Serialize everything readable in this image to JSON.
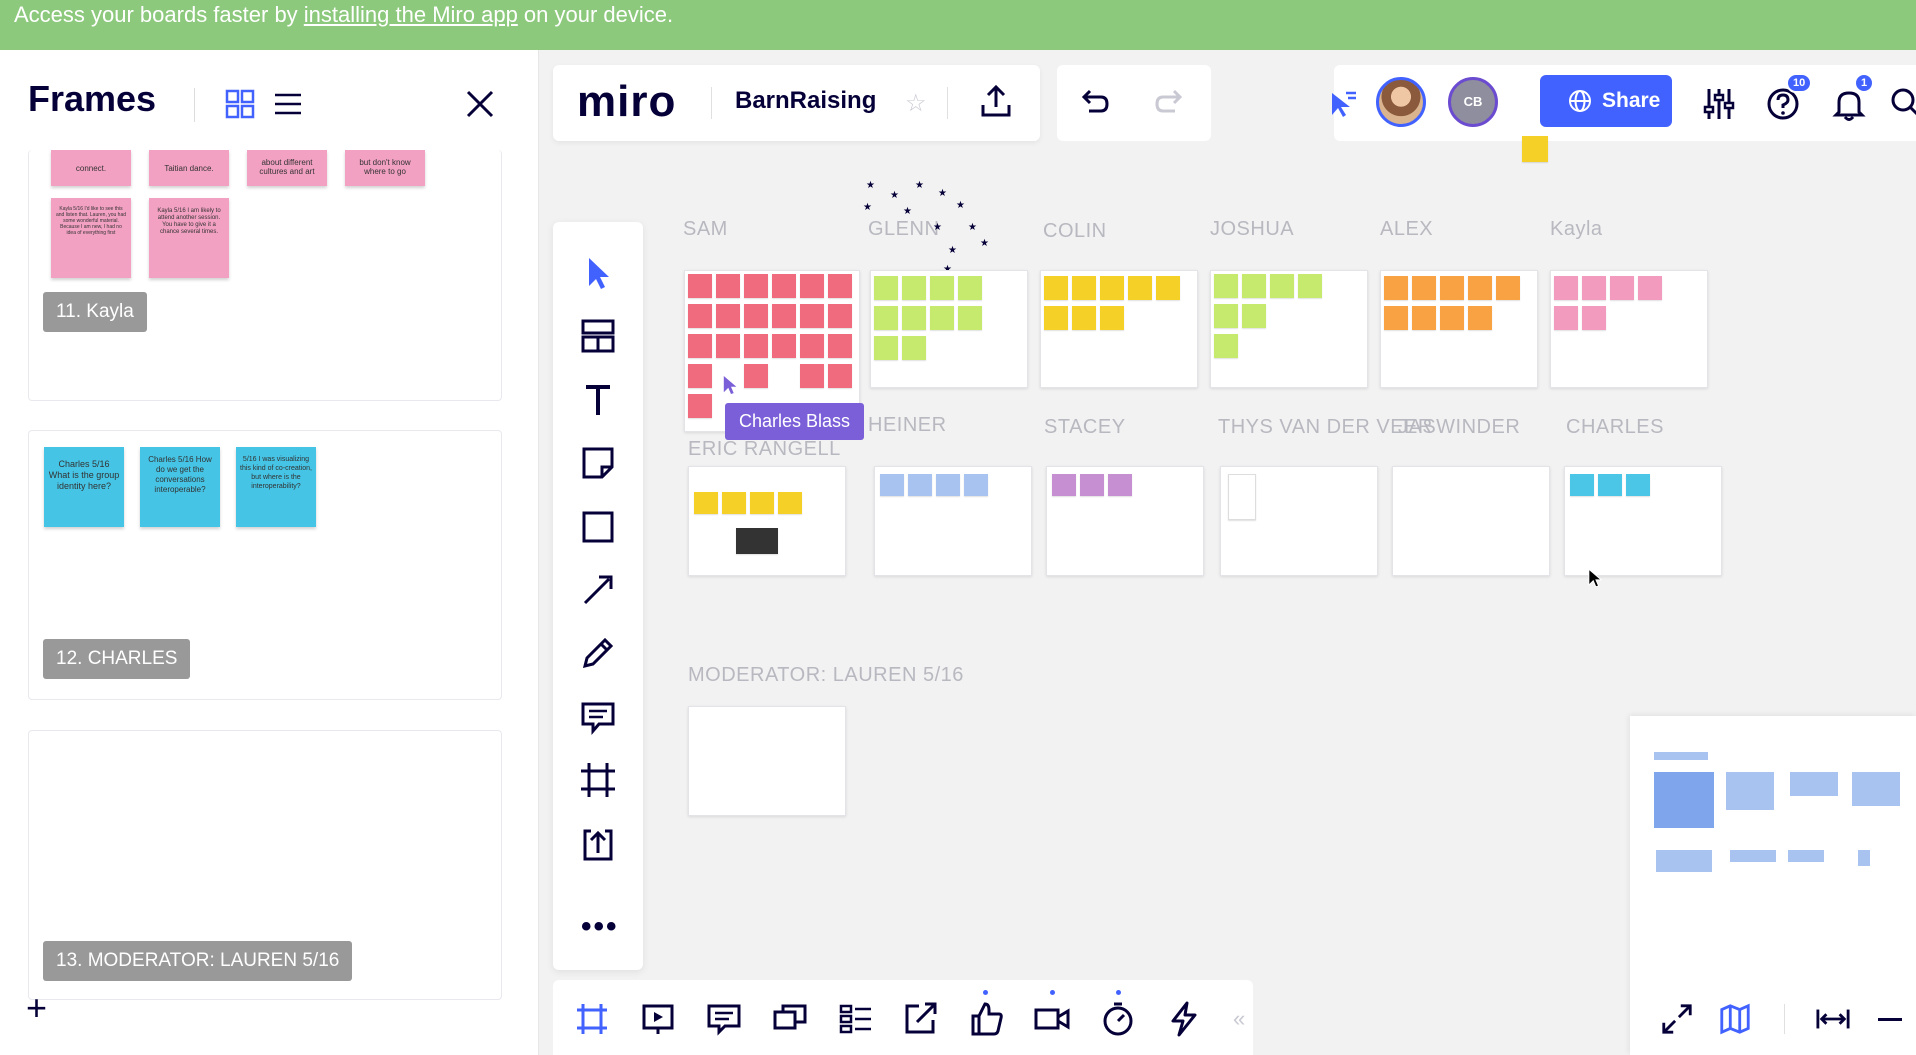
{
  "banner": {
    "prefix": "Access your boards faster by ",
    "link": "installing the Miro app",
    "suffix": " on your device."
  },
  "frames_panel": {
    "title": "Frames",
    "cards": [
      {
        "label": "11. Kayla",
        "stickies_row1": [
          "connect.",
          "Taitian dance.",
          "about different cultures and art",
          "but don't know where to go"
        ],
        "stickies_row2": [
          "Kayla 5/16 I'd like to see this and listen that. Lauren, you had some wonderful material. Because I am new, I had no idea of everything first",
          "Kayla 5/16 I am likely to attend another session. You have to give it a chance several times."
        ]
      },
      {
        "label": "12. CHARLES",
        "stickies": [
          "Charles 5/16 What is the group identity here?",
          "Charles 5/16 How do we get the conversations interoperable?",
          "5/16 I was visualizing this kind of co-creation, but where is the interoperability?"
        ]
      },
      {
        "label": "13. MODERATOR: LAUREN 5/16"
      }
    ],
    "add_label": "+"
  },
  "topbar": {
    "logo": "miro",
    "board_name": "BarnRaising",
    "avatar_initials": "CB",
    "share_label": "Share",
    "help_badge": "10",
    "notif_badge": "1"
  },
  "canvas": {
    "row1_labels": [
      "SAM",
      "GLENN",
      "COLIN",
      "JOSHUA",
      "ALEX",
      "Kayla"
    ],
    "row2_labels": [
      "ERIC RANGELL",
      "HEINER",
      "STACEY",
      "THYS VAN DER VEER",
      "JASWINDER",
      "CHARLES"
    ],
    "moderator_label": "MODERATOR: LAUREN 5/16",
    "cursor_user": "Charles Blass"
  },
  "colors": {
    "accent": "#4262ff",
    "banner": "#8dc97d",
    "cursor_tag": "#7b5fd9"
  }
}
